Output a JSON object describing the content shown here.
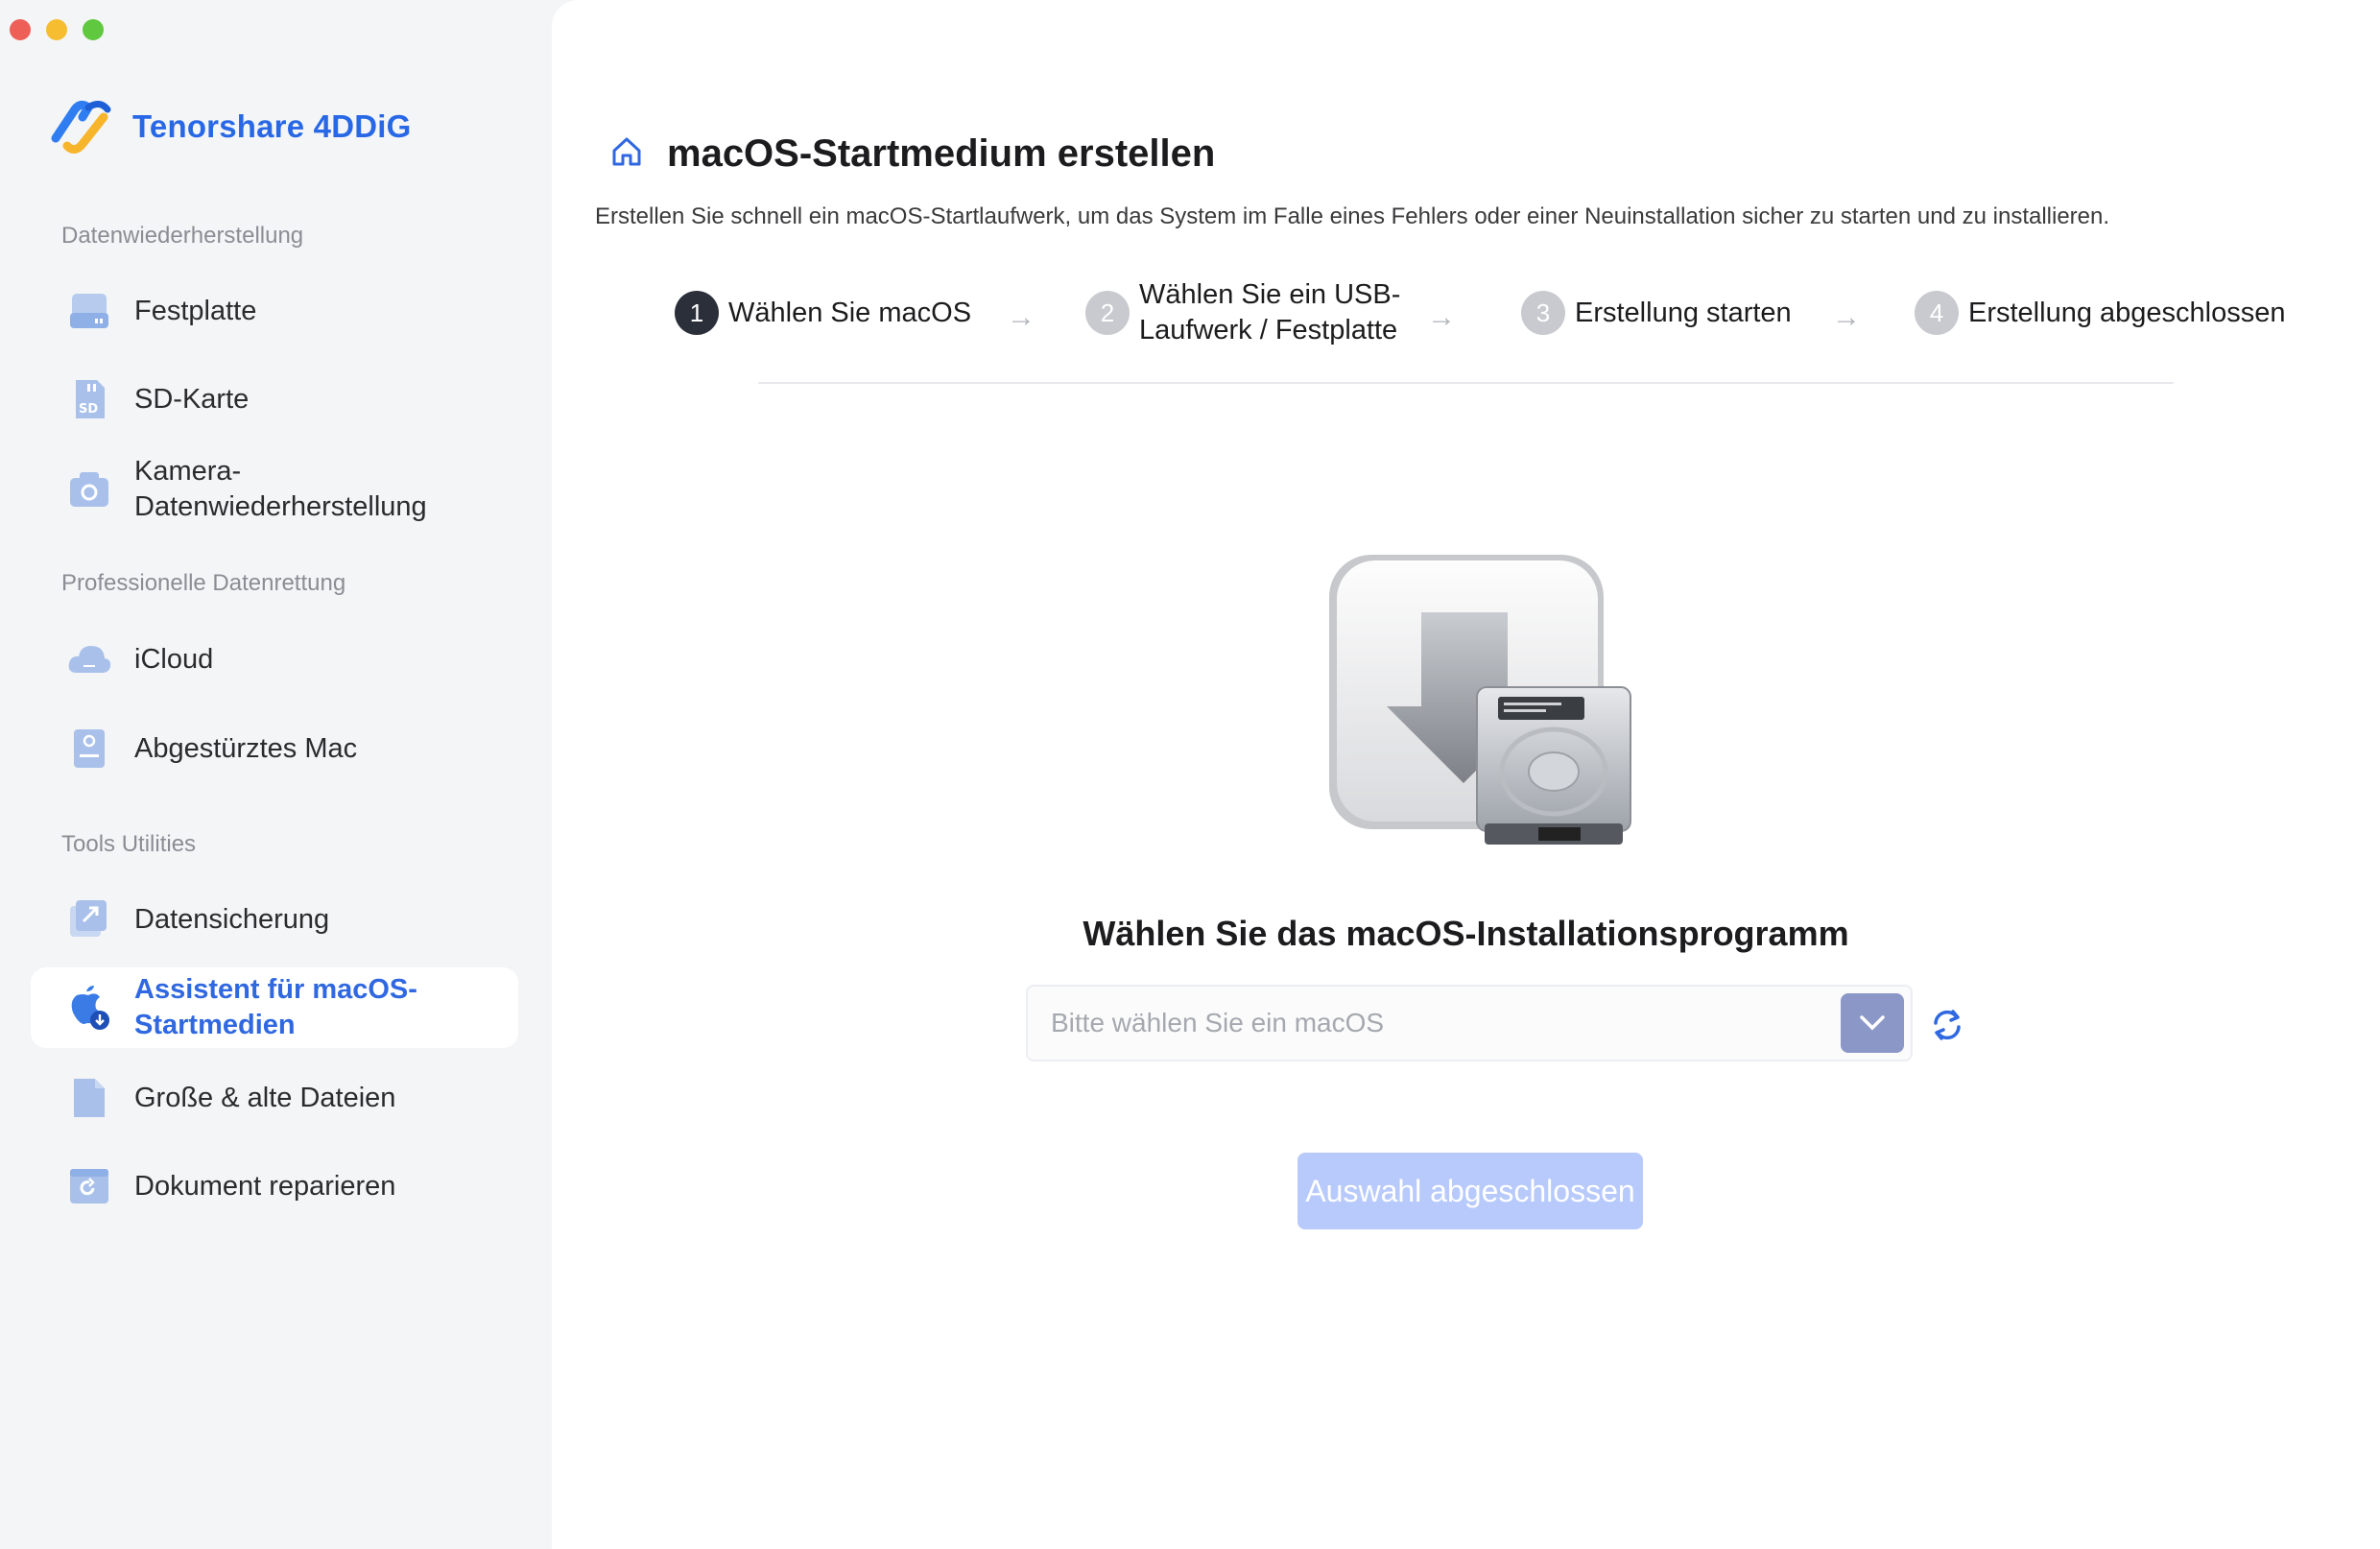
{
  "app": {
    "name": "Tenorshare 4DDiG",
    "colors": {
      "accent": "#2868e6",
      "active_text": "#2f68e0",
      "button_disabled": "#b8cafb",
      "dropdown_button": "#8b97c7"
    }
  },
  "sidebar": {
    "sections": [
      {
        "title": "Datenwiederherstellung"
      },
      {
        "title": "Professionelle Datenrettung"
      },
      {
        "title": "Tools  Utilities"
      }
    ],
    "items": [
      {
        "label": "Festplatte",
        "icon": "hard-drive-icon"
      },
      {
        "label": "SD-Karte",
        "icon": "sd-card-icon"
      },
      {
        "label": "Kamera-Datenwiederherstellung",
        "icon": "camera-icon"
      },
      {
        "label": "iCloud",
        "icon": "cloud-icon"
      },
      {
        "label": "Abgestürztes Mac",
        "icon": "crashed-mac-icon"
      },
      {
        "label": "Datensicherung",
        "icon": "backup-icon"
      },
      {
        "label": "Assistent für macOS-Startmedien",
        "icon": "macos-boot-icon",
        "active": true
      },
      {
        "label": "Große & alte Dateien",
        "icon": "file-icon"
      },
      {
        "label": "Dokument reparieren",
        "icon": "document-repair-icon"
      }
    ]
  },
  "main": {
    "title": "macOS-Startmedium erstellen",
    "description": "Erstellen Sie schnell ein macOS-Startlaufwerk, um das System im Falle eines Fehlers oder einer Neuinstallation sicher zu starten und zu installieren.",
    "steps": [
      {
        "num": "1",
        "label": "Wählen Sie macOS",
        "active": true
      },
      {
        "num": "2",
        "label": "Wählen Sie ein USB-Laufwerk / Festplatte",
        "active": false
      },
      {
        "num": "3",
        "label": "Erstellung starten",
        "active": false
      },
      {
        "num": "4",
        "label": "Erstellung abgeschlossen",
        "active": false
      }
    ],
    "step_arrow": "→",
    "choose_title": "Wählen Sie das macOS-Installationsprogramm",
    "select_placeholder": "Bitte wählen Sie ein macOS",
    "confirm_button": "Auswahl abgeschlossen"
  }
}
